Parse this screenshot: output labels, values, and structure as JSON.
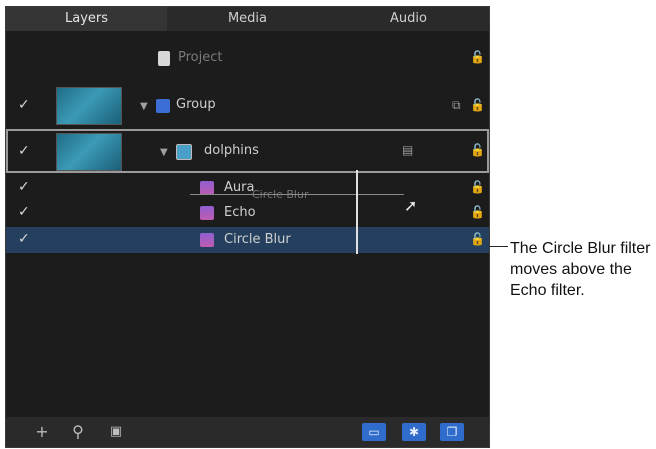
{
  "tabs": [
    "Layers",
    "Media",
    "Audio"
  ],
  "rows": {
    "project": {
      "label": "Project"
    },
    "group": {
      "label": "Group"
    },
    "dolphins": {
      "label": "dolphins"
    },
    "aura": {
      "label": "Aura"
    },
    "echo": {
      "label": "Echo"
    },
    "circle_blur": {
      "label": "Circle Blur"
    }
  },
  "drag": {
    "ghost_label": "Circle Blur"
  },
  "callout": {
    "text": "The Circle Blur filter moves above the Echo filter."
  },
  "check_glyph": "✓",
  "colors": {
    "panel": "#1c1c1c",
    "selected_row": "#24405e",
    "accent": "#2f6ccb"
  },
  "icons": [
    "lock-icon",
    "disclosure-triangle-icon",
    "filter-icon",
    "group-icon",
    "image-layer-icon",
    "add-icon",
    "search-icon",
    "import-icon"
  ]
}
